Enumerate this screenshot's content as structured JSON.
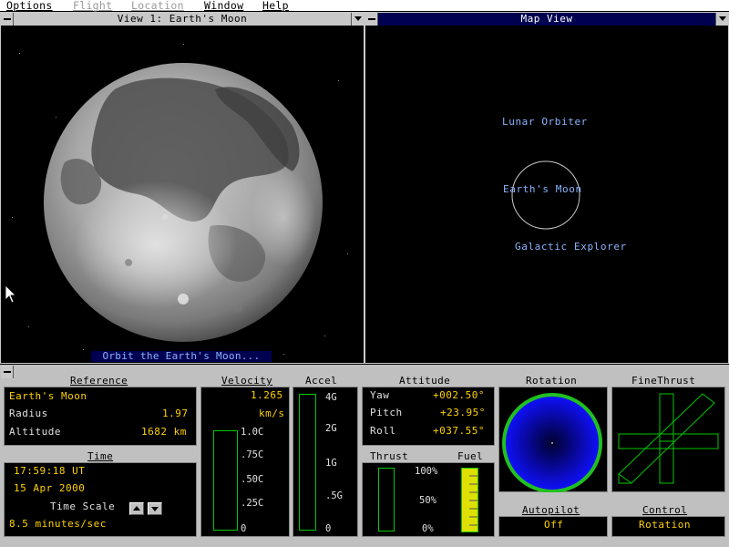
{
  "menu": {
    "items": [
      {
        "label": "Options",
        "enabled": true
      },
      {
        "label": "Flight",
        "enabled": false
      },
      {
        "label": "Location",
        "enabled": false
      },
      {
        "label": "Window",
        "enabled": true
      },
      {
        "label": "Help",
        "enabled": true
      }
    ]
  },
  "view1": {
    "title": "View 1: Earth's Moon",
    "caption": "Orbit the Earth's Moon..."
  },
  "mapview": {
    "title": "Map View",
    "labels": {
      "orbiter": "Lunar Orbiter",
      "moon": "Earth's Moon",
      "explorer": "Galactic Explorer"
    }
  },
  "reference": {
    "heading": "Reference",
    "object": "Earth's Moon",
    "radius_label": "Radius",
    "radius_value": "1.97",
    "altitude_label": "Altitude",
    "altitude_value": "1682 km"
  },
  "time": {
    "heading": "Time",
    "clock": "17:59:18 UT",
    "date": "15 Apr 2000",
    "scale_label": "Time Scale",
    "scale_value": "8.5 minutes/sec"
  },
  "velocity": {
    "heading": "Velocity",
    "value": "1.265",
    "unit": "km/s",
    "scale": [
      "1.0C",
      ".75C",
      ".50C",
      ".25C",
      "0"
    ]
  },
  "accel": {
    "heading": "Accel",
    "scale": [
      "4G",
      "2G",
      "1G",
      ".5G",
      "0"
    ]
  },
  "attitude": {
    "heading": "Attitude",
    "yaw_label": "Yaw",
    "yaw_value": "+002.50°",
    "pitch_label": "Pitch",
    "pitch_value": "+23.95°",
    "roll_label": "Roll",
    "roll_value": "+037.55°"
  },
  "thrust": {
    "heading": "Thrust",
    "fuel_heading": "Fuel",
    "scale": [
      "100%",
      "50%",
      "0%"
    ],
    "fuel_level": 1.0
  },
  "rotation": {
    "heading": "Rotation"
  },
  "finethrust": {
    "heading": "FineThrust"
  },
  "autopilot": {
    "heading": "Autopilot",
    "value": "Off"
  },
  "control": {
    "heading": "Control",
    "value": "Rotation"
  },
  "colors": {
    "accent_yellow": "#ffd200",
    "gauge_green": "#00c800",
    "label_blue": "#8cb4ff",
    "title_navy": "#000050"
  }
}
